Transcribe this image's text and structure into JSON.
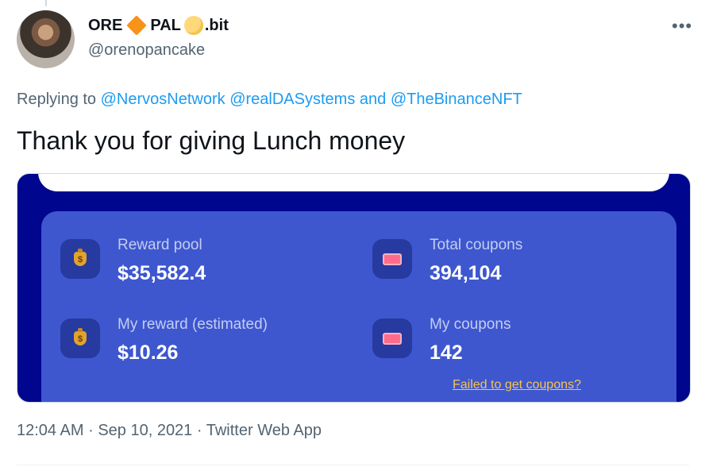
{
  "author": {
    "name_part1": "ORE",
    "name_part2": "PAL",
    "name_suffix": ".bit",
    "handle": "@orenopancake",
    "emoji_icons": [
      "orange-diamond-icon",
      "full-moon-icon"
    ]
  },
  "menu": {
    "more_label": "•••"
  },
  "reply": {
    "prefix": "Replying to",
    "mention1": "@NervosNetwork",
    "mention2": "@realDASystems",
    "and_word": "and",
    "mention3": "@TheBinanceNFT"
  },
  "tweet": {
    "text": "Thank you for giving Lunch money"
  },
  "media": {
    "stats": [
      {
        "label": "Reward pool",
        "value": "$35,582.4",
        "icon": "money-bag-icon"
      },
      {
        "label": "Total coupons",
        "value": "394,104",
        "icon": "ticket-icon"
      },
      {
        "label": "My reward (estimated)",
        "value": "$10.26",
        "icon": "money-bag-icon"
      },
      {
        "label": "My coupons",
        "value": "142",
        "icon": "ticket-icon"
      }
    ],
    "failed_link": "Failed to get coupons?"
  },
  "meta": {
    "time": "12:04 AM",
    "date": "Sep 10, 2021",
    "source": "Twitter Web App",
    "separator": "·"
  },
  "colors": {
    "link": "#1d9bf0",
    "secondary_text": "#536471",
    "media_background": "#00068e",
    "stats_card": "#3e57cf",
    "failed_link": "#f8c54a"
  }
}
